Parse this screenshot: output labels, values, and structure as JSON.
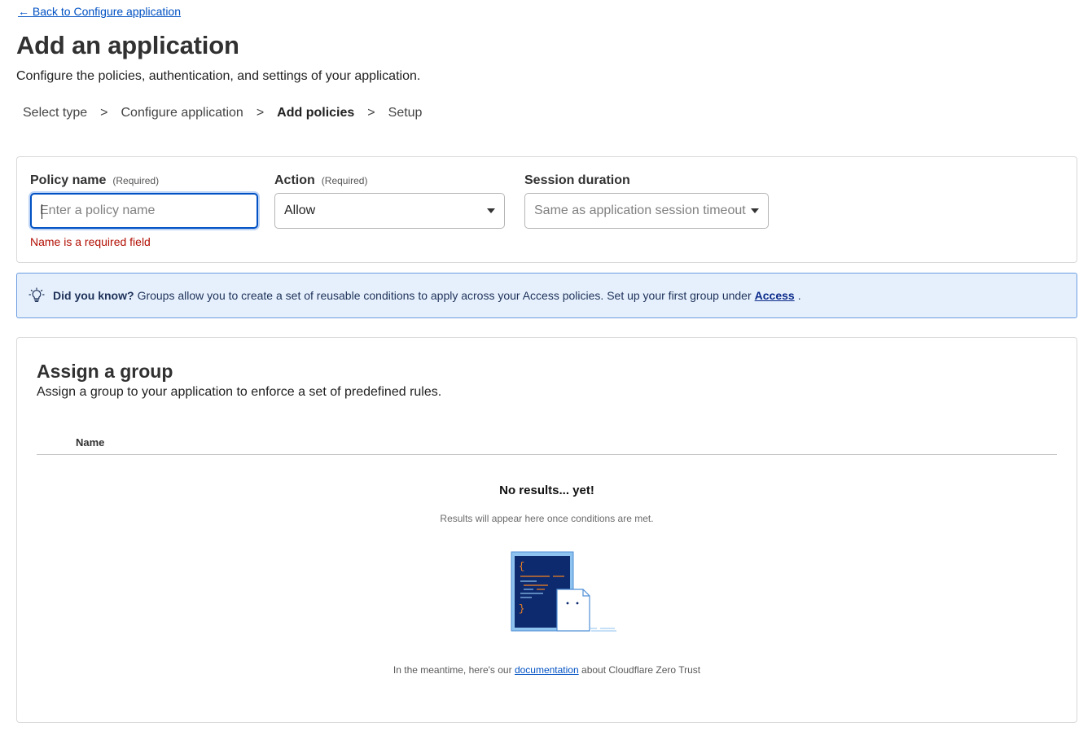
{
  "navigation": {
    "back_link": "← Back to Configure application"
  },
  "header": {
    "title": "Add an application",
    "subtitle": "Configure the policies, authentication, and settings of your application."
  },
  "steps": [
    {
      "label": "Select type",
      "active": false
    },
    {
      "label": "Configure application",
      "active": false
    },
    {
      "label": "Add policies",
      "active": true
    },
    {
      "label": "Setup",
      "active": false
    }
  ],
  "step_separator": ">",
  "policy_form": {
    "policy_name": {
      "label": "Policy name",
      "required_tag": "(Required)",
      "placeholder": "Enter a policy name",
      "value": "",
      "error": "Name is a required field"
    },
    "action": {
      "label": "Action",
      "required_tag": "(Required)",
      "selected": "Allow"
    },
    "session_duration": {
      "label": "Session duration",
      "placeholder": "Same as application session timeout"
    }
  },
  "info_banner": {
    "lead": "Did you know?",
    "text": "Groups allow you to create a set of reusable conditions to apply across your Access policies. Set up your first group under",
    "link": "Access",
    "trailing": "."
  },
  "assign_group": {
    "title": "Assign a group",
    "subtitle": "Assign a group to your application to enforce a set of predefined rules.",
    "columns": [
      "Name"
    ],
    "empty_title": "No results... yet!",
    "empty_subtitle": "Results will appear here once conditions are met.",
    "footer_prefix": "In the meantime, here's our",
    "footer_link": "documentation",
    "footer_suffix": "about Cloudflare Zero Trust"
  },
  "colors": {
    "link": "#0051c3",
    "focus": "#0051c3",
    "error": "#b20f03",
    "banner_bg": "#e6f0fd",
    "banner_border": "#6b9de0",
    "illustration_navy": "#0d2a6e",
    "illustration_light": "#8ec2ef",
    "code_orange": "#f6821f"
  },
  "icons": {
    "info_banner": "lightbulb-icon",
    "select_arrow": "triangle-down-icon"
  }
}
